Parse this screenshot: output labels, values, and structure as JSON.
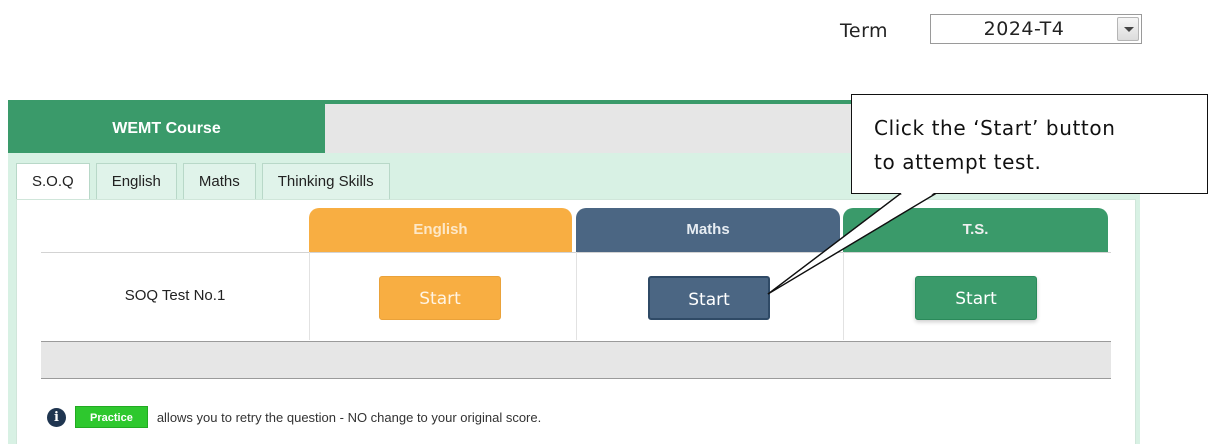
{
  "term": {
    "label": "Term",
    "selected": "2024-T4"
  },
  "course": {
    "title": "WEMT Course"
  },
  "tabs": [
    {
      "label": "S.O.Q",
      "active": true
    },
    {
      "label": "English",
      "active": false
    },
    {
      "label": "Maths",
      "active": false
    },
    {
      "label": "Thinking Skills",
      "active": false
    }
  ],
  "subjects": {
    "english": "English",
    "maths": "Maths",
    "ts": "T.S."
  },
  "tests": [
    {
      "name": "SOQ Test No.1",
      "english_button": "Start",
      "maths_button": "Start",
      "ts_button": "Start"
    }
  ],
  "note": {
    "info_icon_glyph": "i",
    "badge": "Practice",
    "text": "allows you to retry the question - NO change to your original score."
  },
  "callout": {
    "line1": "Click the ‘Start’ button",
    "line2": "to attempt test."
  },
  "colors": {
    "english": "#f8ae42",
    "maths": "#4b6683",
    "ts": "#3a9a6a",
    "practice": "#2ec82e"
  },
  "icons": {
    "info": "info-circle-icon",
    "term_dropdown": "chevron-down-icon"
  }
}
